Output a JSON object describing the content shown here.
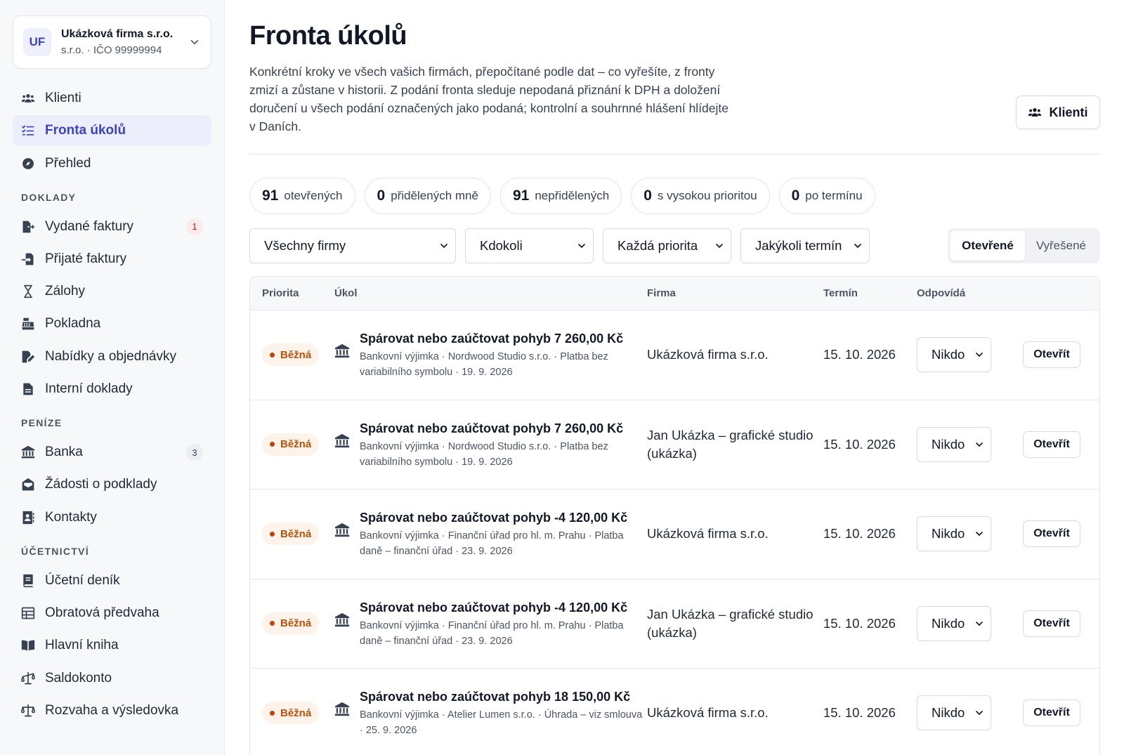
{
  "company": {
    "initials": "UF",
    "name": "Ukázková firma s.r.o.",
    "meta": "s.r.o. · IČO 99999994"
  },
  "nav_main": [
    {
      "label": "Klienti",
      "icon": "users-icon"
    },
    {
      "label": "Fronta úkolů",
      "icon": "list-check-icon",
      "active": true
    },
    {
      "label": "Přehled",
      "icon": "compass-icon"
    }
  ],
  "sections": {
    "doklady": "DOKLADY",
    "penize": "PENÍZE",
    "ucetnictvi": "ÚČETNICTVÍ"
  },
  "nav_doklady": [
    {
      "label": "Vydané faktury",
      "icon": "file-export-icon",
      "badge": "1"
    },
    {
      "label": "Přijaté faktury",
      "icon": "file-import-icon"
    },
    {
      "label": "Zálohy",
      "icon": "hourglass-icon"
    },
    {
      "label": "Pokladna",
      "icon": "cash-register-icon"
    },
    {
      "label": "Nabídky a objednávky",
      "icon": "file-signature-icon"
    },
    {
      "label": "Interní doklady",
      "icon": "file-lines-icon"
    }
  ],
  "nav_penize": [
    {
      "label": "Banka",
      "icon": "bank-icon",
      "badge": "3"
    },
    {
      "label": "Žádosti o podklady",
      "icon": "envelope-open-icon"
    },
    {
      "label": "Kontakty",
      "icon": "address-book-icon"
    }
  ],
  "nav_ucetnictvi": [
    {
      "label": "Účetní deník",
      "icon": "book-icon"
    },
    {
      "label": "Obratová předvaha",
      "icon": "table-icon"
    },
    {
      "label": "Hlavní kniha",
      "icon": "book-open-icon"
    },
    {
      "label": "Saldokonto",
      "icon": "scale-unbalanced-icon"
    },
    {
      "label": "Rozvaha a výsledovka",
      "icon": "scale-balanced-icon"
    }
  ],
  "page": {
    "title": "Fronta úkolů",
    "description": "Konkrétní kroky ve všech vašich firmách, přepočítané podle dat – co vyřešíte, z fronty zmizí a zůstane v historii. Z podání fronta sleduje nepodaná přiznání k DPH a doložení doručení u všech podání označených jako podaná; kontrolní a souhrnné hlášení hlídejte v Daních.",
    "clients_button": "Klienti"
  },
  "stats": [
    {
      "count": "91",
      "label": "otevřených"
    },
    {
      "count": "0",
      "label": "přidělených mně"
    },
    {
      "count": "91",
      "label": "nepřidělených"
    },
    {
      "count": "0",
      "label": "s vysokou prioritou"
    },
    {
      "count": "0",
      "label": "po termínu"
    }
  ],
  "filters": {
    "firm": "Všechny firmy",
    "assignee": "Kdokoli",
    "priority": "Každá priorita",
    "term": "Jakýkoli termín"
  },
  "view_toggle": {
    "open": "Otevřené",
    "resolved": "Vyřešené"
  },
  "table": {
    "headers": {
      "priority": "Priorita",
      "task": "Úkol",
      "firm": "Firma",
      "term": "Termín",
      "responsible": "Odpovídá"
    },
    "rows": [
      {
        "priority": "Běžná",
        "title": "Spárovat nebo zaúčtovat pohyb 7 260,00 Kč",
        "subtitle": "Bankovní výjimka · Nordwood Studio s.r.o. · Platba bez variabilního symbolu · 19. 9. 2026",
        "firm": "Ukázková firma s.r.o.",
        "term": "15. 10. 2026",
        "responsible": "Nikdo",
        "action": "Otevřít"
      },
      {
        "priority": "Běžná",
        "title": "Spárovat nebo zaúčtovat pohyb 7 260,00 Kč",
        "subtitle": "Bankovní výjimka · Nordwood Studio s.r.o. · Platba bez variabilního symbolu · 19. 9. 2026",
        "firm": "Jan Ukázka – grafické studio (ukázka)",
        "term": "15. 10. 2026",
        "responsible": "Nikdo",
        "action": "Otevřít"
      },
      {
        "priority": "Běžná",
        "title": "Spárovat nebo zaúčtovat pohyb -4 120,00 Kč",
        "subtitle": "Bankovní výjimka · Finanční úřad pro hl. m. Prahu · Platba daně – finanční úřad · 23. 9. 2026",
        "firm": "Ukázková firma s.r.o.",
        "term": "15. 10. 2026",
        "responsible": "Nikdo",
        "action": "Otevřít"
      },
      {
        "priority": "Běžná",
        "title": "Spárovat nebo zaúčtovat pohyb -4 120,00 Kč",
        "subtitle": "Bankovní výjimka · Finanční úřad pro hl. m. Prahu · Platba daně – finanční úřad · 23. 9. 2026",
        "firm": "Jan Ukázka – grafické studio (ukázka)",
        "term": "15. 10. 2026",
        "responsible": "Nikdo",
        "action": "Otevřít"
      },
      {
        "priority": "Běžná",
        "title": "Spárovat nebo zaúčtovat pohyb 18 150,00 Kč",
        "subtitle": "Bankovní výjimka · Atelier Lumen s.r.o. · Úhrada – viz smlouva · 25. 9. 2026",
        "firm": "Ukázková firma s.r.o.",
        "term": "15. 10. 2026",
        "responsible": "Nikdo",
        "action": "Otevřít"
      }
    ]
  }
}
